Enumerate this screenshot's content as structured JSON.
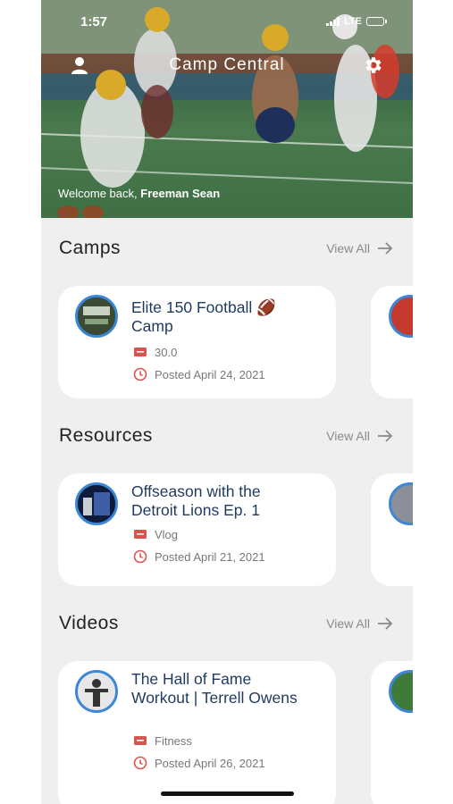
{
  "status_bar": {
    "time": "1:57",
    "network": "LTE"
  },
  "header": {
    "title": "Camp Central",
    "welcome_prefix": "Welcome back,",
    "user_name": "Freeman Sean"
  },
  "sections": {
    "camps": {
      "title": "Camps",
      "view_all": "View All",
      "card": {
        "title": "Elite 150 Football 🏈 Camp",
        "meta_label": "30.0",
        "posted": "Posted April 24, 2021"
      }
    },
    "resources": {
      "title": "Resources",
      "view_all": "View All",
      "card": {
        "title": "Offseason with the Detroit Lions Ep. 1",
        "meta_label": "Vlog",
        "posted": "Posted April 21, 2021"
      }
    },
    "videos": {
      "title": "Videos",
      "view_all": "View All",
      "card": {
        "title": "The Hall of Fame Workout | Terrell Owens",
        "meta_label": "Fitness",
        "posted": "Posted April 26, 2021"
      }
    }
  },
  "colors": {
    "accent_red": "#d9534f",
    "title_blue": "#1f3a5f",
    "avatar_ring": "#3d86d6",
    "background": "#efefef"
  },
  "icons": [
    "profile-icon",
    "gear-icon",
    "arrow-right-icon",
    "ticket-icon",
    "clock-icon"
  ]
}
